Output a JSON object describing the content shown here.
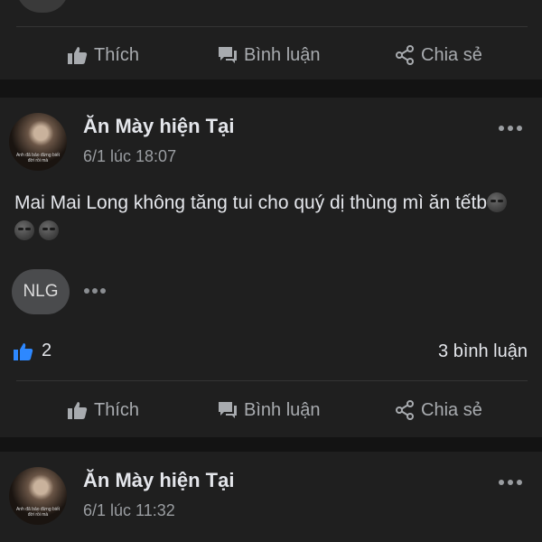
{
  "actions": {
    "like": "Thích",
    "comment": "Bình luận",
    "share": "Chia sẻ"
  },
  "post1": {
    "author": "Ăn Mày hiện Tại",
    "time": "6/1 lúc 18:07",
    "avatar_caption": "Anh đã bảo đừng biết đời rồi mà",
    "text": "Mai Mai Long không tăng tui cho quý dị thùng mì ăn tếtb",
    "emoji_count": 3,
    "comment_preview_initials": "NLG",
    "like_count": "2",
    "comment_count": "3 bình luận"
  },
  "post2": {
    "author": "Ăn Mày hiện Tại",
    "time": "6/1 lúc 11:32",
    "avatar_caption": "Anh đã bảo đừng biết đời rồi mà"
  },
  "colors": {
    "background": "#131313",
    "card": "#1f1f1f",
    "like_blue": "#2d88ff",
    "muted": "#a8abaf"
  },
  "icons": [
    "thumbs-up-icon",
    "comment-icon",
    "share-icon",
    "more-options-icon",
    "emoji-icon"
  ]
}
